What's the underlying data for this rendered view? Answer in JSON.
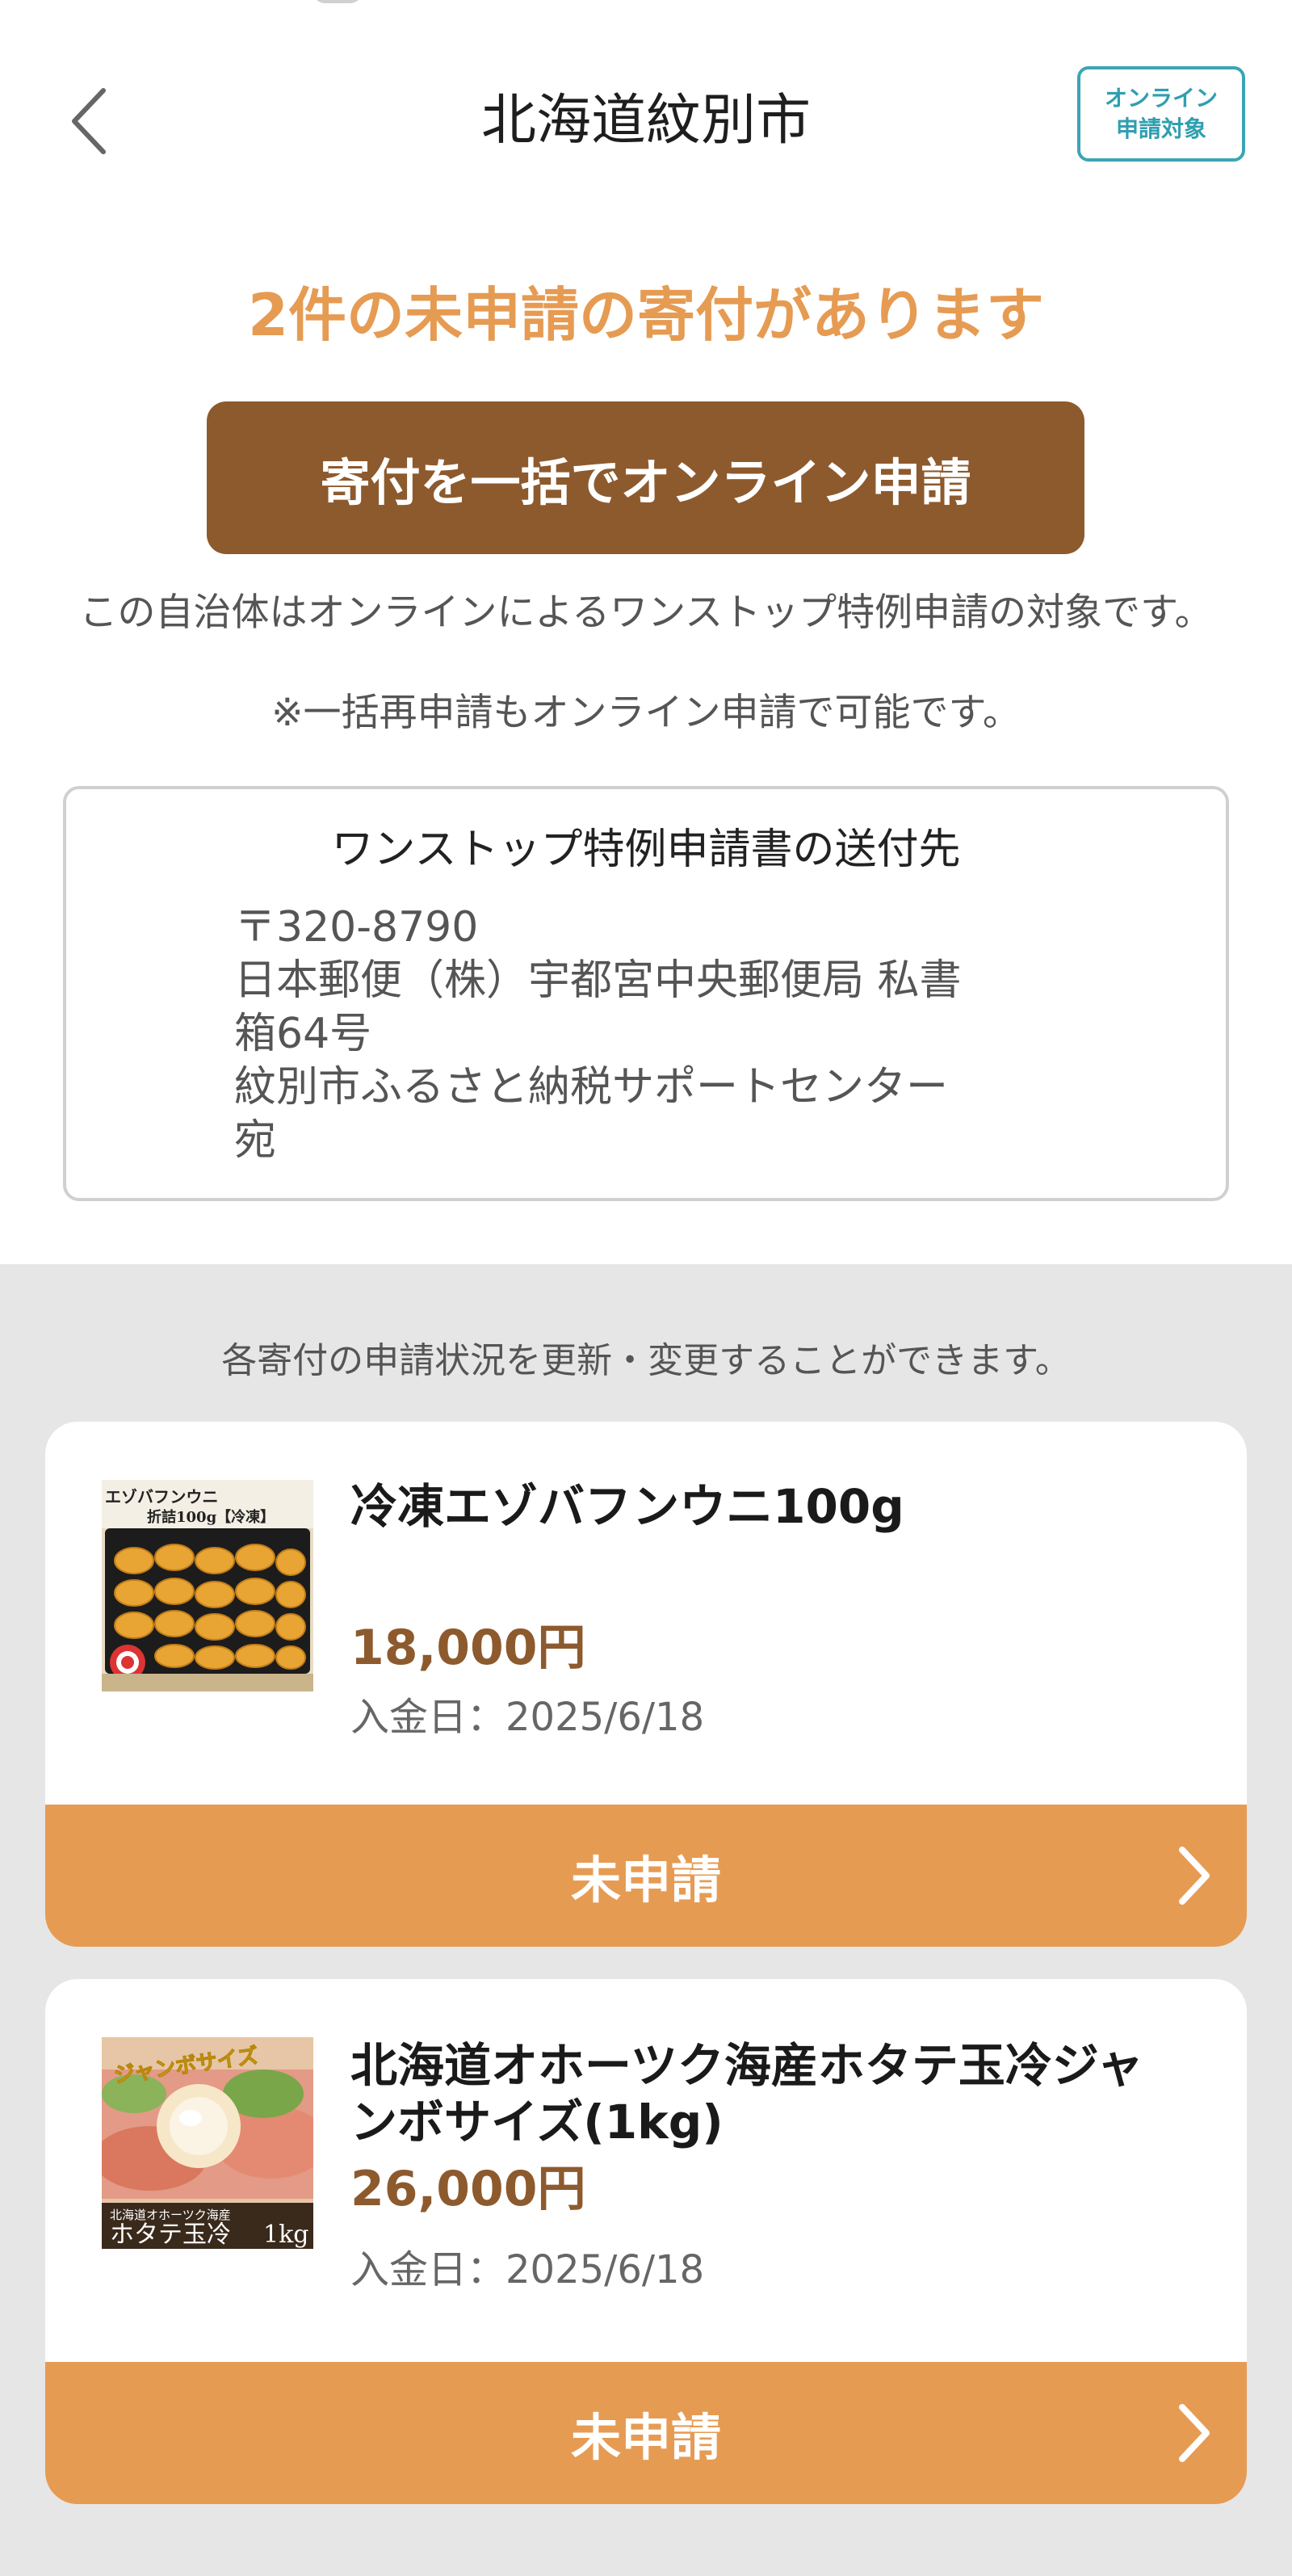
{
  "header": {
    "title": "北海道紋別市",
    "badge_line1": "オンライン",
    "badge_line2": "申請対象",
    "back_icon": "chevron-left-icon"
  },
  "summary": {
    "alert": "2件の未申請の寄付があります",
    "bulk_button_label": "寄付を一括でオンライン申請",
    "description": "この自治体はオンラインによるワンストップ特例申請の対象です。",
    "note": "※一括再申請もオンライン申請で可能です。"
  },
  "address": {
    "title": "ワンストップ特例申請書の送付先",
    "lines": [
      "〒320-8790",
      "日本郵便（株）宇都宮中央郵便局 私書",
      "箱64号",
      "紋別市ふるさと納税サポートセンター",
      "宛"
    ]
  },
  "donations": {
    "section_note": "各寄付の申請状況を更新・変更することができます。",
    "paid_label": "入金日：",
    "items": [
      {
        "name": "冷凍エゾバフンウニ100g",
        "price": "18,000円",
        "paid_date": "2025/6/18",
        "status": "未申請",
        "thumb_line1": "エゾバフンウニ",
        "thumb_line2": "折詰100g【冷凍】"
      },
      {
        "name": "北海道オホーツク海産ホタテ玉冷ジャンボサイズ(1kg)",
        "price": "26,000円",
        "paid_date": "2025/6/18",
        "status": "未申請",
        "thumb_line1": "ジャンボサイズ",
        "thumb_line2": "北海道オホーツク海産",
        "thumb_line3": "ホタテ玉冷",
        "thumb_line4": "1kg"
      }
    ]
  },
  "colors": {
    "accent_orange": "#e69b53",
    "brand_brown": "#8d5a2e",
    "badge_teal": "#3aa5b5"
  }
}
